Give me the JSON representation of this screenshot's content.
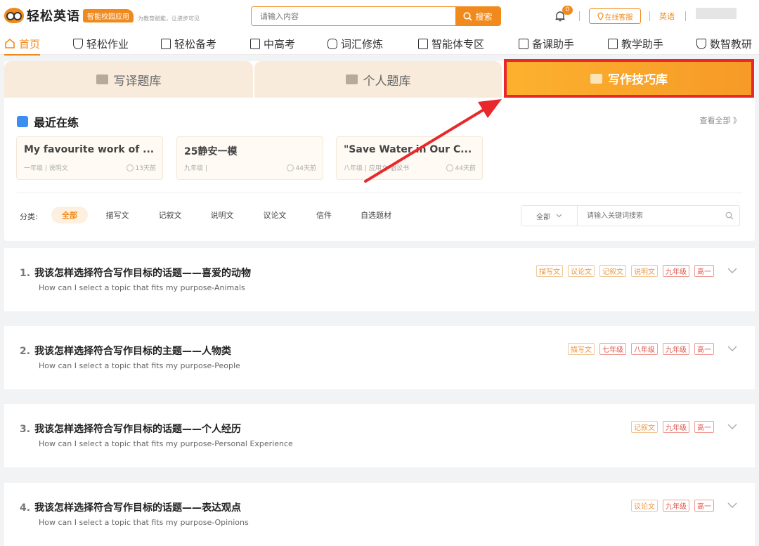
{
  "header": {
    "logo_text": "轻松英语",
    "logo_badge": "智能校园应用",
    "slogan": "为教育赋能，让进步可见",
    "search_placeholder": "请输入内容",
    "search_button": "搜索",
    "notification_count": "0",
    "service_label": "在线客服",
    "language": "英语"
  },
  "nav": {
    "items": [
      "首页",
      "轻松作业",
      "轻松备考",
      "中高考",
      "词汇修炼",
      "智能体专区",
      "备课助手",
      "教学助手",
      "数智教研"
    ]
  },
  "tabs": [
    "写译题库",
    "个人题库",
    "写作技巧库"
  ],
  "recent": {
    "title": "最近在练",
    "view_all": "查看全部 》",
    "cards": [
      {
        "title": "My favourite work of ...",
        "meta": "一年级 | 说明文",
        "time": "13天前"
      },
      {
        "title": "25静安一模",
        "meta": "九年级 |",
        "time": "44天前"
      },
      {
        "title": "\"Save Water in Our C...",
        "meta": "八年级 | 应用文-倡议书",
        "time": "44天前"
      }
    ]
  },
  "filter": {
    "label": "分类:",
    "chips": [
      "全部",
      "描写文",
      "记叙文",
      "说明文",
      "议论文",
      "信件",
      "自选题材"
    ],
    "select_value": "全部",
    "search_placeholder": "请输入关键词搜索"
  },
  "items": [
    {
      "num": "1.",
      "title": "我该怎样选择符合写作目标的话题——喜爱的动物",
      "subtitle": "How can I select a topic that fits my purpose-Animals",
      "tags": [
        "描写文",
        "议论文",
        "记叙文",
        "说明文",
        "九年级",
        "高一"
      ]
    },
    {
      "num": "2.",
      "title": "我该怎样选择符合写作目标的主题——人物类",
      "subtitle": "How can I select a topic that fits my purpose-People",
      "tags": [
        "描写文",
        "七年级",
        "八年级",
        "九年级",
        "高一"
      ]
    },
    {
      "num": "3.",
      "title": "我该怎样选择符合写作目标的话题——个人经历",
      "subtitle": "How can I select a topic that fits my purpose-Personal Experience",
      "tags": [
        "记叙文",
        "九年级",
        "高一"
      ]
    },
    {
      "num": "4.",
      "title": "我该怎样选择符合写作目标的话题——表达观点",
      "subtitle": "How can I select a topic that fits my purpose-Opinions",
      "tags": [
        "议论文",
        "九年级",
        "高一"
      ]
    }
  ],
  "colors": {
    "accent": "#f08a1c",
    "highlight_border": "#e8282a",
    "annotation_arrow": "#e8282a"
  }
}
